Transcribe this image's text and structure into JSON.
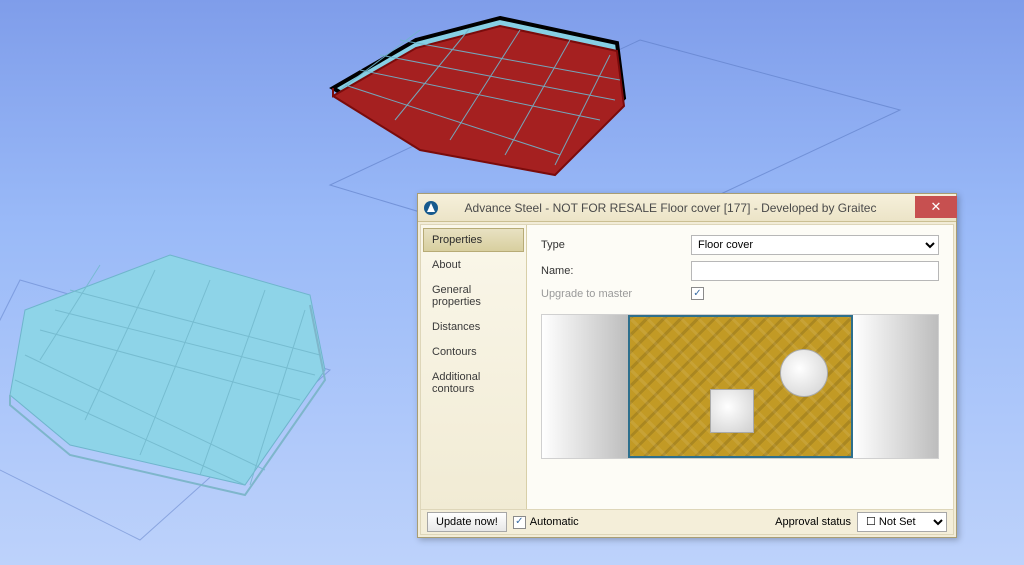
{
  "dialog": {
    "title": "Advance Steel - NOT FOR RESALE   Floor cover [177] - Developed by Graitec",
    "close_icon": "✕"
  },
  "sidebar": {
    "items": [
      {
        "label": "Properties",
        "id": "properties"
      },
      {
        "label": "About",
        "id": "about"
      },
      {
        "label": "General properties",
        "id": "general"
      },
      {
        "label": "Distances",
        "id": "distances"
      },
      {
        "label": "Contours",
        "id": "contours"
      },
      {
        "label": "Additional contours",
        "id": "addcontours"
      }
    ],
    "selected": "properties"
  },
  "form": {
    "type_label": "Type",
    "type_value": "Floor cover",
    "name_label": "Name:",
    "name_value": "",
    "upgrade_label": "Upgrade to master",
    "upgrade_checked": true
  },
  "footer": {
    "update_label": "Update now!",
    "automatic_label": "Automatic",
    "automatic_checked": true,
    "approval_label": "Approval status",
    "approval_value": "Not Set"
  },
  "icons": {
    "app": "▲",
    "check": "✓"
  }
}
